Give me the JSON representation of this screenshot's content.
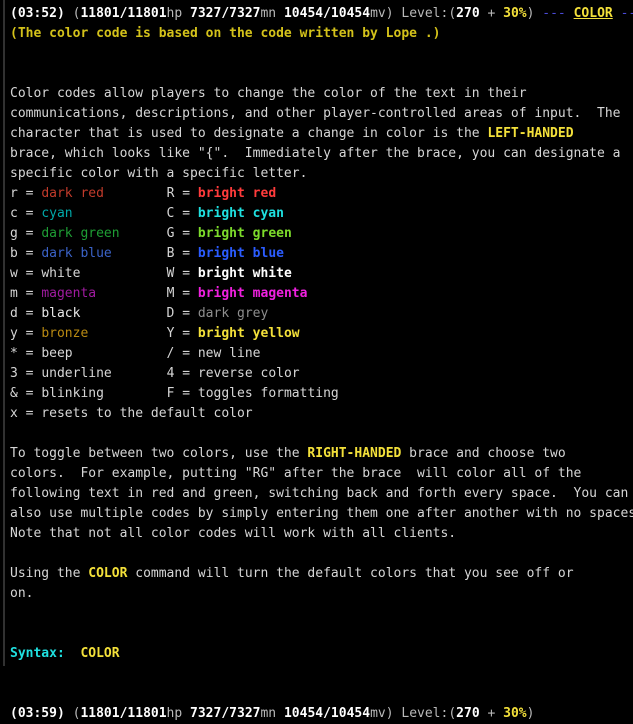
{
  "terminal": {
    "background_color": "#000000",
    "default_text_color": "#d6d6d6",
    "accent_yellow": "#f3e03a",
    "accent_cyan": "#1fe0e0",
    "accent_blue": "#4a4ad6"
  },
  "status_top": {
    "time": "(03:52)",
    "open_paren": "(",
    "hp_value": "11801/11801",
    "hp_label": "hp",
    "mana_value": "7327/7327",
    "mana_label": "mn",
    "move_value": "10454/10454",
    "move_label": "mv",
    "close_paren": ")",
    "level_label": "Level:(",
    "level_value": "270",
    "level_plus": " + ",
    "level_percent": "30%",
    "level_close": ")",
    "dash_left": "---",
    "command_name": "COLOR",
    "dash_right": "---"
  },
  "credit_line": "(The color code is based on the code written by Lope .)",
  "intro": {
    "line1": "Color codes allow players to change the color of the text in their",
    "line2_a": "communications, descriptions, and other player-controlled areas of input.  The",
    "line3_a": "character that is used to designate a change in color is the ",
    "line3_highlight": "LEFT-HANDED",
    "line4": "brace, which looks like \"{\".  Immediately after the brace, you can designate a",
    "line5": "specific color with a specific letter."
  },
  "code_table": {
    "rows": [
      {
        "left_code": "r",
        "left_eq": " = ",
        "left_name": "dark red",
        "left_class": "c-dred",
        "right_code": "R",
        "right_eq": " = ",
        "right_name": "bright red",
        "right_class": "c-bred"
      },
      {
        "left_code": "c",
        "left_eq": " = ",
        "left_name": "cyan",
        "left_class": "c-cyan",
        "right_code": "C",
        "right_eq": " = ",
        "right_name": "bright cyan",
        "right_class": "c-bcyan"
      },
      {
        "left_code": "g",
        "left_eq": " = ",
        "left_name": "dark green",
        "left_class": "c-dgreen",
        "right_code": "G",
        "right_eq": " = ",
        "right_name": "bright green",
        "right_class": "c-bgreen"
      },
      {
        "left_code": "b",
        "left_eq": " = ",
        "left_name": "dark blue",
        "left_class": "c-dblue",
        "right_code": "B",
        "right_eq": " = ",
        "right_name": "bright blue",
        "right_class": "c-bblue"
      },
      {
        "left_code": "w",
        "left_eq": " = ",
        "left_name": "white",
        "left_class": "c-white",
        "right_code": "W",
        "right_eq": " = ",
        "right_name": "bright white",
        "right_class": "c-bwhite"
      },
      {
        "left_code": "m",
        "left_eq": " = ",
        "left_name": "magenta",
        "left_class": "c-magenta",
        "right_code": "M",
        "right_eq": " = ",
        "right_name": "bright magenta",
        "right_class": "c-bmagenta"
      },
      {
        "left_code": "d",
        "left_eq": " = ",
        "left_name": "black",
        "left_class": "c-black",
        "right_code": "D",
        "right_eq": " = ",
        "right_name": "dark grey",
        "right_class": "c-dgrey"
      },
      {
        "left_code": "y",
        "left_eq": " = ",
        "left_name": "bronze",
        "left_class": "c-bronze",
        "right_code": "Y",
        "right_eq": " = ",
        "right_name": "bright yellow",
        "right_class": "c-byellow"
      },
      {
        "left_code": "*",
        "left_eq": " = ",
        "left_name": "beep",
        "left_class": "c-default",
        "right_code": "/",
        "right_eq": " = ",
        "right_name": "new line",
        "right_class": "c-default"
      },
      {
        "left_code": "3",
        "left_eq": " = ",
        "left_name": "underline",
        "left_class": "c-default",
        "right_code": "4",
        "right_eq": " = ",
        "right_name": "reverse color",
        "right_class": "c-default"
      },
      {
        "left_code": "&",
        "left_eq": " = ",
        "left_name": "blinking",
        "left_class": "c-default",
        "right_code": "F",
        "right_eq": " = ",
        "right_name": "toggles formatting",
        "right_class": "c-default"
      }
    ],
    "final_row": "x = resets to the default color"
  },
  "toggle_paragraph": {
    "line1_a": "To toggle between two colors, use the ",
    "line1_highlight": "RIGHT-HANDED",
    "line1_b": " brace and choose two",
    "line2": "colors.  For example, putting \"RG\" after the brace  will color all of the",
    "line3": "following text in red and green, switching back and forth every space.  You can",
    "line4": "also use multiple codes by simply entering them one after another with no spaces.",
    "line5": "Note that not all color codes will work with all clients."
  },
  "command_paragraph": {
    "line1_a": "Using the ",
    "line1_highlight": "COLOR",
    "line1_b": " command will turn the default colors that you see off or",
    "line2": "on."
  },
  "syntax": {
    "label": "Syntax:",
    "spacer": "  ",
    "command": "COLOR"
  },
  "status_bottom": {
    "time": "(03:59)",
    "open_paren": "(",
    "hp_value": "11801/11801",
    "hp_label": "hp",
    "mana_value": "7327/7327",
    "mana_label": "mn",
    "move_value": "10454/10454",
    "move_label": "mv",
    "close_paren": ")",
    "level_label": "Level:(",
    "level_value": "270",
    "level_plus": " + ",
    "level_percent": "30%",
    "level_close": ")"
  }
}
